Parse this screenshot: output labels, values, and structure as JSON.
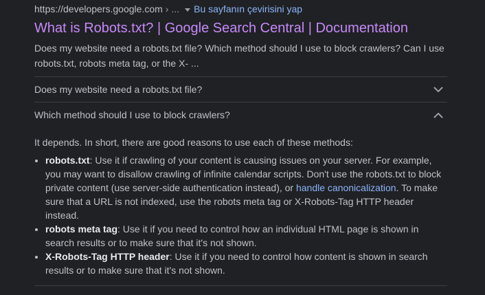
{
  "result": {
    "url": "https://developers.google.com",
    "url_sep": "›",
    "url_more": "...",
    "translate_label": "Bu sayfanın çevirisini yap",
    "title": "What is Robots.txt? | Google Search Central | Documentation",
    "snippet": "Does my website need a robots.txt file? Which method should I use to block crawlers? Can I use robots.txt, robots meta tag, or the X- ..."
  },
  "faq": {
    "items": [
      {
        "question": "Does my website need a robots.txt file?",
        "expanded": false,
        "icon": "chevron-down-icon"
      },
      {
        "question": "Which method should I use to block crawlers?",
        "expanded": true,
        "icon": "chevron-up-icon",
        "answer": {
          "intro": "It depends. In short, there are good reasons to use each of these methods:",
          "bullets": [
            {
              "term": "robots.txt",
              "text_before": ": Use it if crawling of your content is causing issues on your server. For example, you may want to disallow crawling of infinite calendar scripts. Don't use the robots.txt to block private content (use server-side authentication instead), or ",
              "link": "handle canonicalization",
              "text_after": ". To make sure that a URL is not indexed, use the robots meta tag or X-Robots-Tag HTTP header instead."
            },
            {
              "term": "robots meta tag",
              "text": ": Use it if you need to control how an individual HTML page is shown in search results or to make sure that it's not shown."
            },
            {
              "term": "X-Robots-Tag HTTP header",
              "text": ": Use it if you need to control how content is shown in search results or to make sure that it's not shown."
            }
          ]
        }
      }
    ]
  },
  "colors": {
    "background": "#202124",
    "text": "#bdc1c6",
    "title_visited": "#c58af9",
    "link": "#8ab4f8",
    "divider": "#3c4043"
  }
}
